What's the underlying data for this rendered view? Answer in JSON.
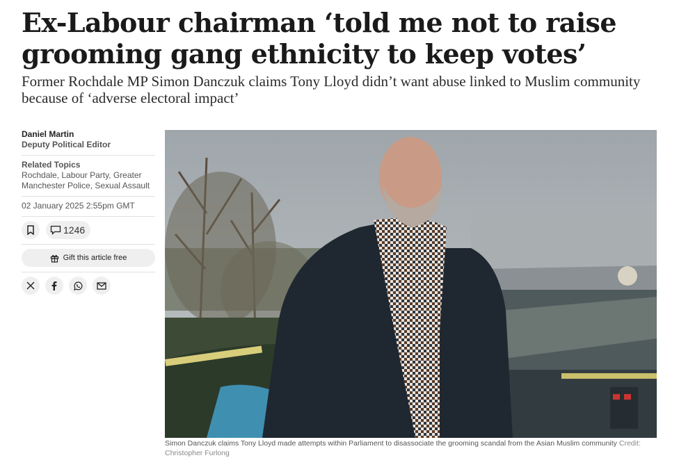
{
  "article": {
    "headline": "Ex-Labour chairman ‘told me not to raise grooming gang ethnicity to keep votes’",
    "standfirst": "Former Rochdale MP Simon Danczuk claims Tony Lloyd didn’t want abuse linked to Muslim community because of ‘adverse electoral impact’"
  },
  "byline": {
    "author": "Daniel Martin",
    "role": "Deputy Political Editor",
    "topics_label": "Related Topics",
    "topics": "Rochdale, Labour Party, Greater Manchester Police, Sexual Assault",
    "date": "02 January 2025 2:55pm GMT"
  },
  "actions": {
    "bookmark_icon": "bookmark-icon",
    "comment_icon": "comment-icon",
    "comment_count": "1246",
    "gift_icon": "gift-icon",
    "gift_label": "Gift this article free"
  },
  "share": [
    "x-icon",
    "facebook-icon",
    "whatsapp-icon",
    "email-icon"
  ],
  "image": {
    "caption": "Simon Danczuk claims Tony Lloyd made attempts within Parliament to disassociate the grooming scandal from the Asian Muslim community",
    "credit": "Credit: Christopher Furlong"
  },
  "colors": {
    "text": "#1a1a1a",
    "muted": "#555555",
    "button_bg": "#efefef"
  }
}
